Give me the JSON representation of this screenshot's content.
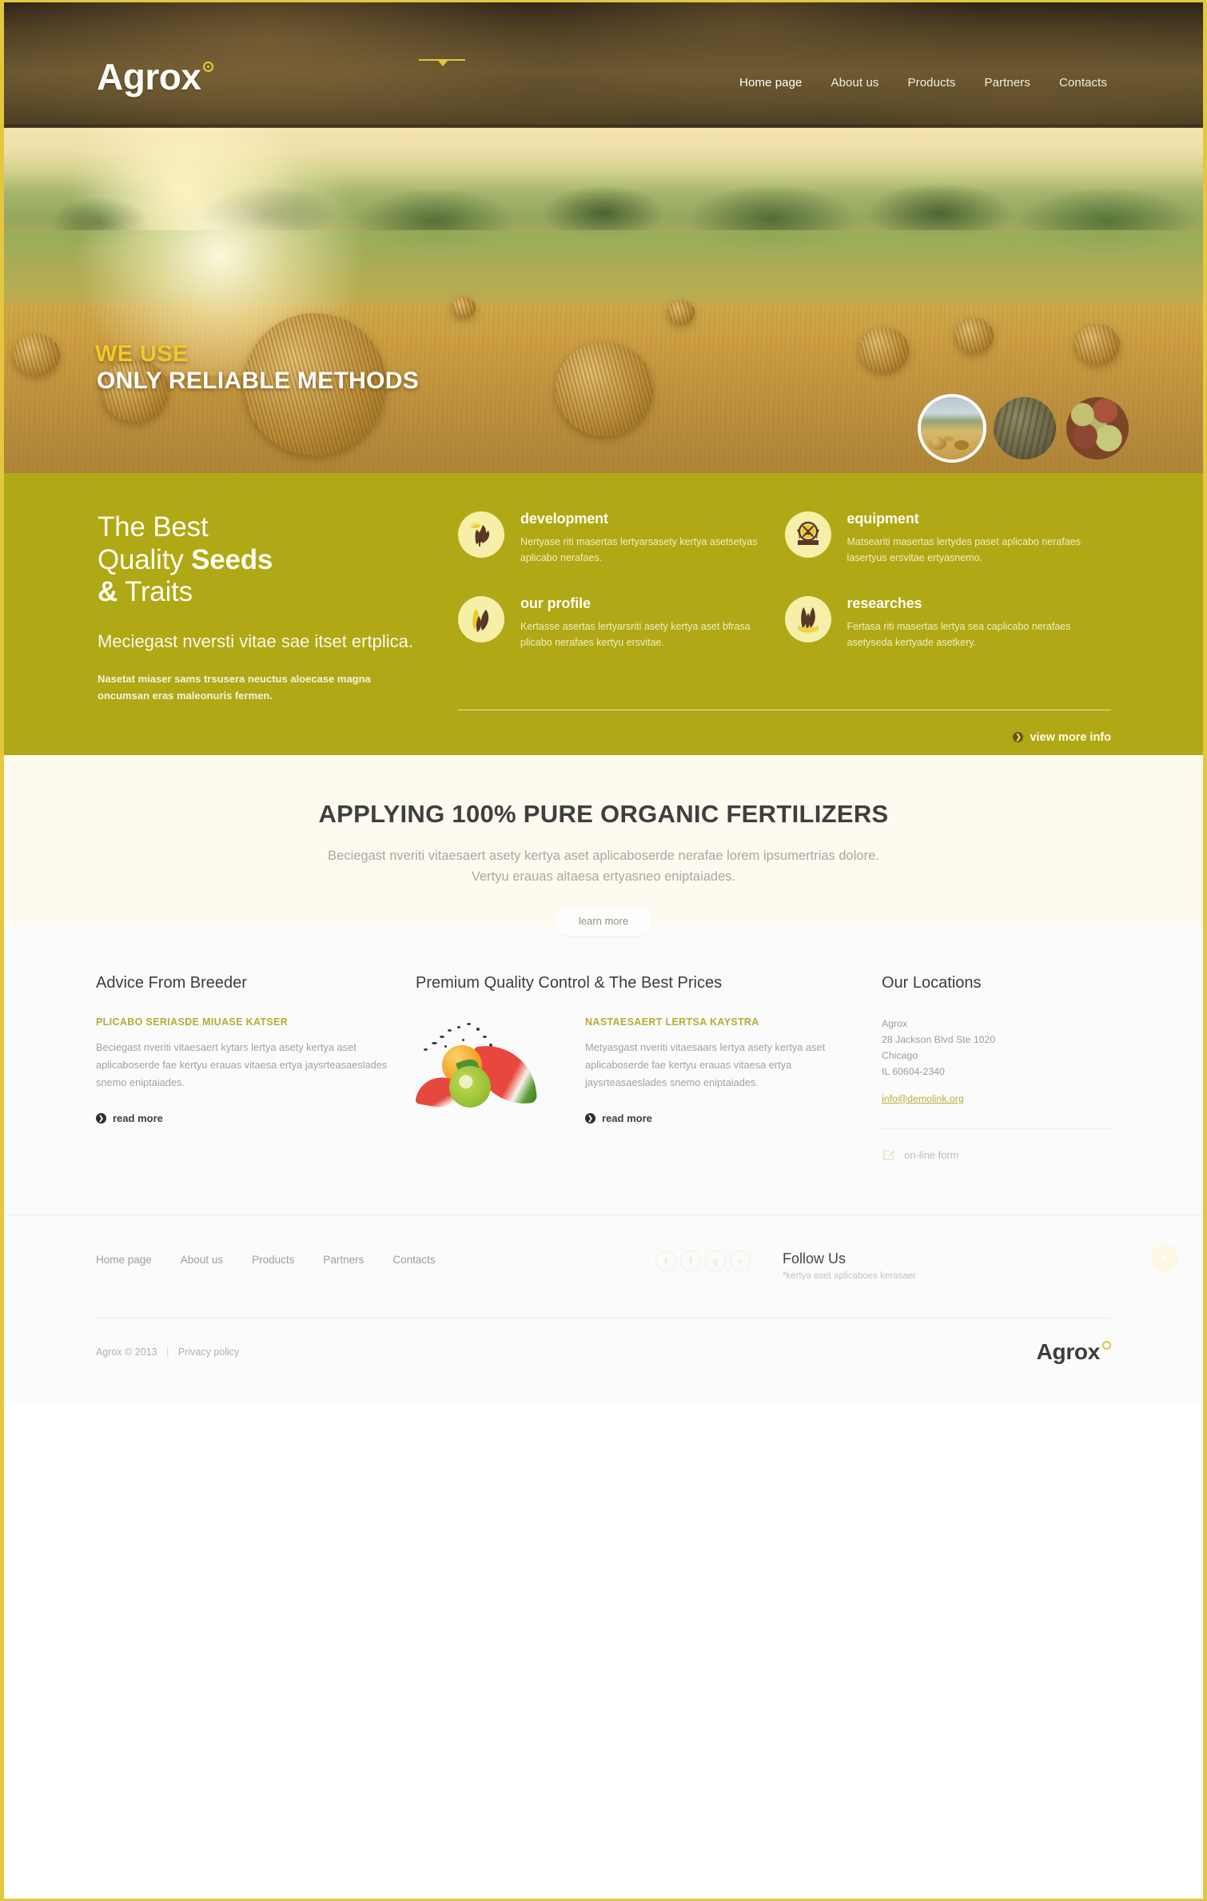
{
  "site": {
    "brand": "Agrox",
    "brand_mark": "registered-mark"
  },
  "header": {
    "nav": [
      {
        "label": "Home page",
        "active": true
      },
      {
        "label": "About us",
        "active": false
      },
      {
        "label": "Products",
        "active": false
      },
      {
        "label": "Partners",
        "active": false
      },
      {
        "label": "Contacts",
        "active": false
      }
    ]
  },
  "hero": {
    "line1": "WE USE",
    "line2": "ONLY RELIABLE METHODS",
    "thumbs": [
      {
        "name": "hay-field-thumbnail",
        "active": true
      },
      {
        "name": "wheat-ears-thumbnail",
        "active": false
      },
      {
        "name": "potatoes-thumbnail",
        "active": false
      }
    ]
  },
  "olive": {
    "heading_line1_light": "The Best",
    "heading_line2_light": "Quality ",
    "heading_line2_bold": "Seeds",
    "heading_line3_bold": "&",
    "heading_line3_light": " Traits",
    "subheading": "Meciegast nversti vitae sae itset ertplica.",
    "paragraph": "Nasetat miaser sams trsusera neuctus aloecase magna oncumsan eras maleonuris fermen.",
    "features": [
      {
        "icon": "wheat-sun-icon",
        "title": "development",
        "text": "Nertyase riti masertas lertyarsasety kertya asetsetyas aplicabo nerafaes."
      },
      {
        "icon": "windmill-emblem-icon",
        "title": "equipment",
        "text": "Matseariti masertas lertydes paset aplicabo nerafaes lasertyus ersvitae ertyasnemo."
      },
      {
        "icon": "two-wheat-ears-icon",
        "title": "our profile",
        "text": "Kertasse asertas lertyarsriti asety kertya aset bfrasa plicabo nerafaes kertyu ersvitae."
      },
      {
        "icon": "wheat-banner-icon",
        "title": "researches",
        "text": "Fertasa riti masertas lertya sea caplicabo nerafaes asetyseda kertyade asetkery."
      }
    ],
    "view_more_label": "view more info",
    "accent_color": "#b0a815"
  },
  "cream": {
    "heading": "APPLYING 100% PURE ORGANIC FERTILIZERS",
    "paragraph_line1": "Beciegast nveriti vitaesaert asety kertya aset aplicaboserde nerafae lorem ipsumertrias dolore.",
    "paragraph_line2": "Vertyu erauas aitaesa ertyasneo eniptaiades.",
    "button_label": "learn more"
  },
  "content": {
    "col_a": {
      "title": "Advice From Breeder",
      "kicker": "PLICABO SERIASDE MIUASE KATSER",
      "text": "Beciegast nveriti vitaesaert kytars lertya asety kertya aset aplicaboserde fae kertyu erauas vitaesa ertya jaysrteasaeslades snemo eniptaiades.",
      "read_more": "read more"
    },
    "col_b": {
      "title": "Premium Quality Control & The Best Prices",
      "image_name": "fruit-splash-image",
      "kicker": "NASTAESAERT LERTSA KAYSTRA",
      "text": "Metyasgast nveriti vitaesaars lertya asety kertya aset aplicaboserde fae kertyu erauas vitaesa ertya jaysrteasaeslades snemo eniptaiades.",
      "read_more": "read more"
    },
    "col_c": {
      "title": "Our Locations",
      "company": "Agrox",
      "street": "28 Jackson Blvd Ste 1020",
      "city": "Chicago",
      "region": "IL 60604-2340",
      "email": "info@demolink.org",
      "online_form_label": "on-line form"
    }
  },
  "footer": {
    "nav": [
      {
        "label": "Home page"
      },
      {
        "label": "About us"
      },
      {
        "label": "Products"
      },
      {
        "label": "Partners"
      },
      {
        "label": "Contacts"
      }
    ],
    "socials": [
      {
        "name": "twitter-icon",
        "glyph": "t"
      },
      {
        "name": "facebook-icon",
        "glyph": "f"
      },
      {
        "name": "google-plus-icon",
        "glyph": "g"
      },
      {
        "name": "rss-icon",
        "glyph": "»"
      }
    ],
    "follow_title": "Follow Us",
    "follow_note": "*kertya aset aplicaboes kerasaer",
    "to_top_label": "▲",
    "copyright": "Agrox © 2013",
    "separator": "|",
    "privacy": "Privacy policy",
    "brand": "Agrox"
  }
}
